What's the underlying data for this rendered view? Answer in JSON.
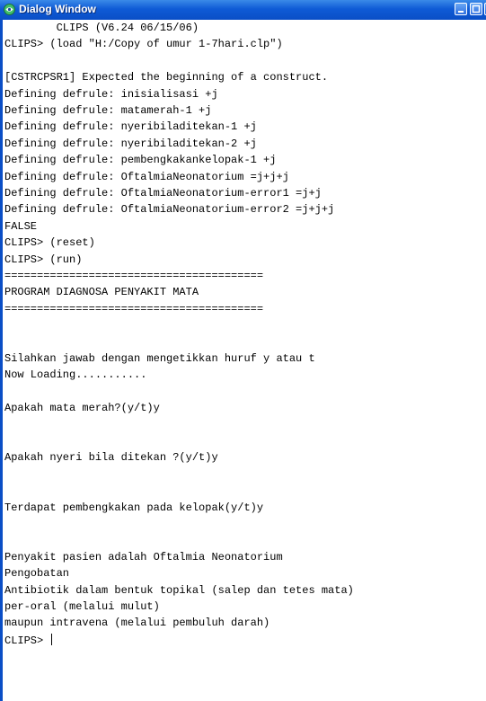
{
  "window": {
    "title": "Dialog Window"
  },
  "console": {
    "lines": [
      "        CLIPS (V6.24 06/15/06)",
      "CLIPS> (load \"H:/Copy of umur 1-7hari.clp\")",
      "",
      "[CSTRCPSR1] Expected the beginning of a construct.",
      "Defining defrule: inisialisasi +j",
      "Defining defrule: matamerah-1 +j",
      "Defining defrule: nyeribiladitekan-1 +j",
      "Defining defrule: nyeribiladitekan-2 +j",
      "Defining defrule: pembengkakankelopak-1 +j",
      "Defining defrule: OftalmiaNeonatorium =j+j+j",
      "Defining defrule: OftalmiaNeonatorium-error1 =j+j",
      "Defining defrule: OftalmiaNeonatorium-error2 =j+j+j",
      "FALSE",
      "CLIPS> (reset)",
      "CLIPS> (run)",
      "========================================",
      "PROGRAM DIAGNOSA PENYAKIT MATA",
      "========================================",
      "",
      "",
      "Silahkan jawab dengan mengetikkan huruf y atau t",
      "Now Loading...........",
      "",
      "Apakah mata merah?(y/t)y",
      "",
      "",
      "Apakah nyeri bila ditekan ?(y/t)y",
      "",
      "",
      "Terdapat pembengkakan pada kelopak(y/t)y",
      "",
      "",
      "Penyakit pasien adalah Oftalmia Neonatorium",
      "Pengobatan",
      "Antibiotik dalam bentuk topikal (salep dan tetes mata)",
      "per-oral (melalui mulut)",
      "maupun intravena (melalui pembuluh darah)"
    ],
    "prompt": "CLIPS> "
  }
}
